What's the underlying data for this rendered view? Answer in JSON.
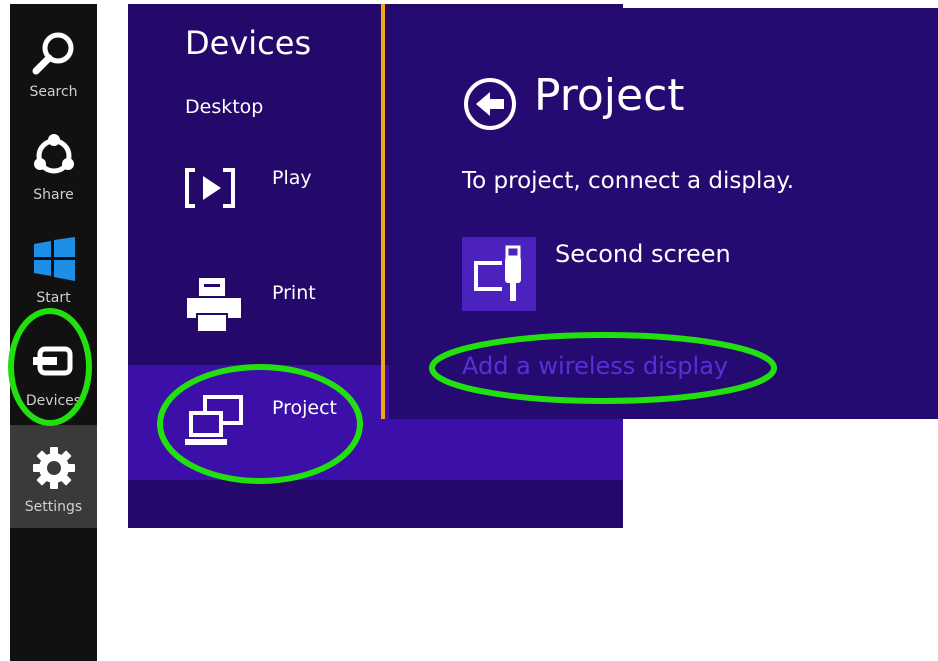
{
  "charms": [
    {
      "label": "Search",
      "icon": "search-icon"
    },
    {
      "label": "Share",
      "icon": "share-icon"
    },
    {
      "label": "Start",
      "icon": "windows-logo-icon"
    },
    {
      "label": "Devices",
      "icon": "devices-icon"
    },
    {
      "label": "Settings",
      "icon": "gear-icon"
    }
  ],
  "devices_pane": {
    "title": "Devices",
    "subtitle": "Desktop",
    "items": [
      {
        "label": "Play",
        "icon": "play-icon"
      },
      {
        "label": "Print",
        "icon": "printer-icon"
      },
      {
        "label": "Project",
        "icon": "project-icon"
      }
    ]
  },
  "project_pane": {
    "title": "Project",
    "instruction": "To project, connect a display.",
    "option_label": "Second screen",
    "wireless_link": "Add a wireless display"
  },
  "colors": {
    "charms_bg": "#111111",
    "pane_bg": "#24096b",
    "active_item": "#3b0fa8",
    "accent": "#f0a712",
    "highlight_ring": "#22e00e",
    "link": "#5a2fd6"
  }
}
